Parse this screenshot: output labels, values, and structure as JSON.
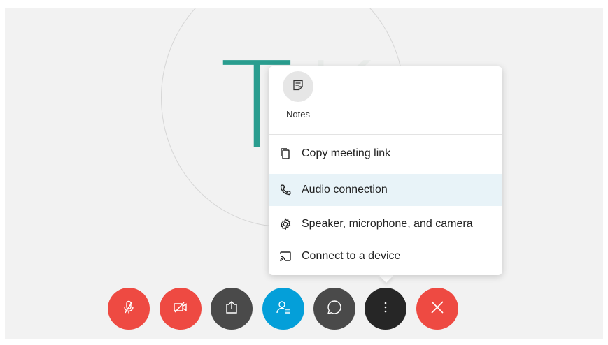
{
  "avatar": {
    "initial_1": "T",
    "initial_2": "K"
  },
  "menu": {
    "notes_label": "Notes",
    "items": [
      {
        "label": "Copy meeting link",
        "icon": "copy-icon"
      },
      {
        "label": "Audio connection",
        "icon": "phone-icon",
        "highlighted": true
      },
      {
        "label": "Speaker, microphone, and camera",
        "icon": "gear-icon"
      },
      {
        "label": "Connect to a device",
        "icon": "cast-icon"
      }
    ]
  },
  "controls": [
    {
      "name": "mute",
      "icon": "mic-off-icon",
      "color": "#ee4a42"
    },
    {
      "name": "stop-video",
      "icon": "video-off-icon",
      "color": "#ee4a42"
    },
    {
      "name": "share",
      "icon": "share-icon",
      "color": "#4a4a4a"
    },
    {
      "name": "participants",
      "icon": "participants-icon",
      "color": "#049fd9"
    },
    {
      "name": "chat",
      "icon": "chat-icon",
      "color": "#4a4a4a"
    },
    {
      "name": "more",
      "icon": "more-icon",
      "color": "#262626"
    },
    {
      "name": "leave",
      "icon": "close-icon",
      "color": "#ee4a42"
    }
  ]
}
